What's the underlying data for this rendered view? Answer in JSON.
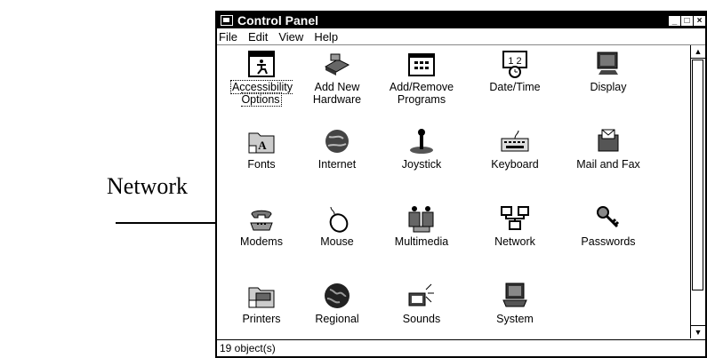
{
  "callout": {
    "label": "Network"
  },
  "window": {
    "title": "Control Panel",
    "menu": [
      {
        "label": "File"
      },
      {
        "label": "Edit"
      },
      {
        "label": "View"
      },
      {
        "label": "Help"
      }
    ],
    "status": "19 object(s)"
  },
  "icons": [
    {
      "label": "Accessibility Options",
      "icon": "accessibility-icon"
    },
    {
      "label": "Add New Hardware",
      "icon": "hardware-icon"
    },
    {
      "label": "Add/Remove Programs",
      "icon": "programs-icon"
    },
    {
      "label": "Date/Time",
      "icon": "calendar-clock-icon"
    },
    {
      "label": "Display",
      "icon": "monitor-icon"
    },
    {
      "label": "Fonts",
      "icon": "fonts-folder-icon"
    },
    {
      "label": "Internet",
      "icon": "globe-icon"
    },
    {
      "label": "Joystick",
      "icon": "joystick-icon"
    },
    {
      "label": "Keyboard",
      "icon": "keyboard-icon"
    },
    {
      "label": "Mail and Fax",
      "icon": "mail-fax-icon"
    },
    {
      "label": "Modems",
      "icon": "phone-icon"
    },
    {
      "label": "Mouse",
      "icon": "mouse-icon"
    },
    {
      "label": "Multimedia",
      "icon": "multimedia-icon"
    },
    {
      "label": "Network",
      "icon": "network-icon"
    },
    {
      "label": "Passwords",
      "icon": "keys-icon"
    },
    {
      "label": "Printers",
      "icon": "printer-folder-icon"
    },
    {
      "label": "Regional",
      "icon": "world-icon"
    },
    {
      "label": "Sounds",
      "icon": "speaker-icon"
    },
    {
      "label": "System",
      "icon": "computer-icon"
    }
  ]
}
